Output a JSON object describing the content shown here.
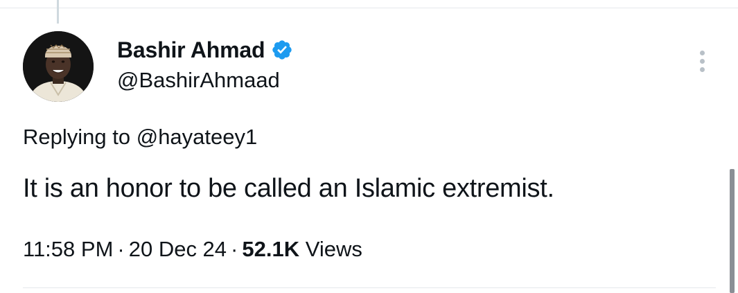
{
  "tweet": {
    "author": {
      "display_name": "Bashir Ahmad",
      "handle": "@BashirAhmaad",
      "verified": true
    },
    "reply": {
      "prefix": "Replying to",
      "to_handle": "@hayateey1"
    },
    "text": "It is an honor to be called an Islamic extremist.",
    "time": "11:58 PM",
    "date": "20 Dec 24",
    "views_count": "52.1K",
    "views_label": "Views",
    "separator": "·"
  },
  "icons": {
    "verified": "verified-badge-icon",
    "more": "more-options-icon"
  },
  "colors": {
    "verified_blue": "#1d9bf0",
    "text": "#0f1419",
    "divider": "#e5e8eb",
    "more_dots": "#b8c0c7"
  }
}
